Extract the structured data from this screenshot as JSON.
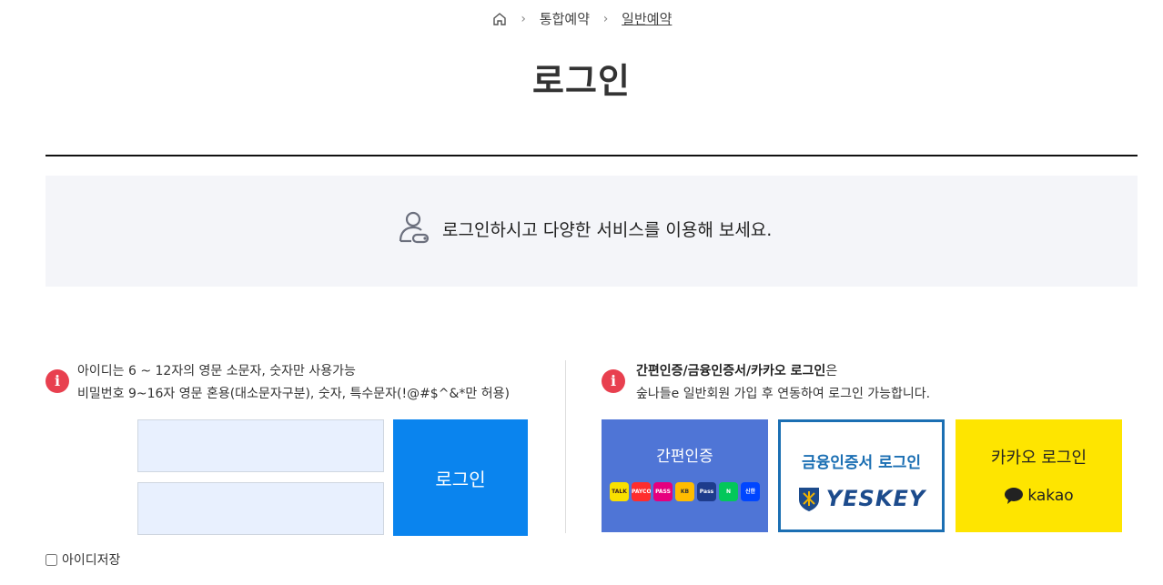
{
  "breadcrumb": {
    "home_icon": "home-icon",
    "items": [
      "통합예약",
      "일반예약"
    ]
  },
  "page_title": "로그인",
  "banner": {
    "icon": "user-key-icon",
    "text": "로그인하시고 다양한 서비스를 이용해 보세요."
  },
  "login": {
    "rule_id": "아이디는 6 ~ 12자의 영문 소문자, 숫자만 사용가능",
    "rule_pw": "비밀번호 9~16자 영문 혼용(대소문자구분), 숫자, 특수문자(!@#$^&*만 허용)",
    "id_placeholder": "",
    "pw_placeholder": "",
    "login_button": "로그인",
    "save_id_label": "아이디저장"
  },
  "auth": {
    "notice_bold": "간편인증/금융인증서/카카오 로그인",
    "notice_suffix": "은",
    "notice_line2": "숲나들e 일반회원 가입 후 연동하여 로그인 가능합니다.",
    "simple_label": "간편인증",
    "simple_chips": [
      {
        "text": "TALK",
        "bg": "#f9e000",
        "color": "#3c1e1e"
      },
      {
        "text": "PAYCO",
        "bg": "#ff2d2d",
        "color": "#ffffff"
      },
      {
        "text": "PASS",
        "bg": "#e6007e",
        "color": "#ffffff"
      },
      {
        "text": "KB",
        "bg": "#ffbc00",
        "color": "#333333"
      },
      {
        "text": "Pass",
        "bg": "#1e3c8c",
        "color": "#ffffff"
      },
      {
        "text": "N",
        "bg": "#03c75a",
        "color": "#ffffff"
      },
      {
        "text": "신한",
        "bg": "#0046ff",
        "color": "#ffffff"
      }
    ],
    "cert_label": "금융인증서 로그인",
    "cert_logo_text": "YESKEY",
    "kakao_label": "카카오 로그인",
    "kakao_logo_text": "kakao"
  },
  "colors": {
    "primary": "#0a84ee",
    "simple_auth": "#4f75d6",
    "cert_border": "#1b6fb3",
    "kakao": "#fee500",
    "info": "#e8404f"
  }
}
